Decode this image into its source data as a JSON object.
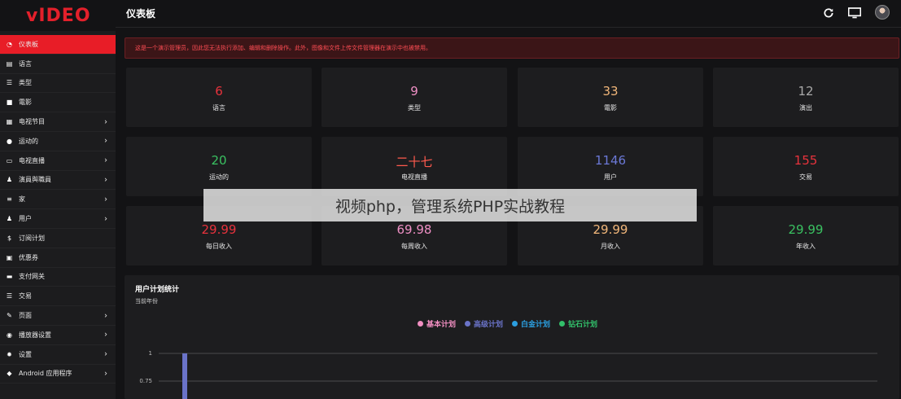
{
  "brand": {
    "logo_text": "vIDEO"
  },
  "header": {
    "title": "仪表板",
    "icons": [
      "refresh-icon",
      "monitor-icon",
      "avatar"
    ]
  },
  "alert": {
    "text": "这是一个演示管理员，因此您无法执行添加、编辑和删除操作。此外，图像和文件上传文件管理器在演示中也被禁用。"
  },
  "sidebar": {
    "items": [
      {
        "label": "仪表板",
        "icon": "dashboard-icon",
        "active": true,
        "chevron": false
      },
      {
        "label": "语言",
        "icon": "language-icon",
        "chevron": false
      },
      {
        "label": "类型",
        "icon": "list-icon",
        "chevron": false
      },
      {
        "label": "電影",
        "icon": "video-camera-icon",
        "chevron": false
      },
      {
        "label": "电视节目",
        "icon": "film-icon",
        "chevron": true
      },
      {
        "label": "运动的",
        "icon": "soccer-ball-icon",
        "chevron": true
      },
      {
        "label": "电视直播",
        "icon": "tv-icon",
        "chevron": true
      },
      {
        "label": "演員與職員",
        "icon": "users-icon",
        "chevron": true
      },
      {
        "label": "家",
        "icon": "sliders-icon",
        "chevron": true
      },
      {
        "label": "用户",
        "icon": "user-group-icon",
        "chevron": true
      },
      {
        "label": "订阅计划",
        "icon": "dollar-icon",
        "chevron": false
      },
      {
        "label": "优惠券",
        "icon": "gift-icon",
        "chevron": false
      },
      {
        "label": "支付网关",
        "icon": "credit-card-icon",
        "chevron": false
      },
      {
        "label": "交易",
        "icon": "list-icon",
        "chevron": false
      },
      {
        "label": "页面",
        "icon": "edit-icon",
        "chevron": true
      },
      {
        "label": "播放器设置",
        "icon": "play-circle-icon",
        "chevron": true
      },
      {
        "label": "设置",
        "icon": "gear-icon",
        "chevron": true
      },
      {
        "label": "Android 应用程序",
        "icon": "android-icon",
        "chevron": true
      }
    ]
  },
  "stats": [
    {
      "value": "6",
      "label": "语言",
      "color": "#e8323c"
    },
    {
      "value": "9",
      "label": "类型",
      "color": "#ee8fc4"
    },
    {
      "value": "33",
      "label": "電影",
      "color": "#f2b77a"
    },
    {
      "value": "12",
      "label": "演出",
      "color": "#a9a9a9"
    },
    {
      "value": "20",
      "label": "运动的",
      "color": "#3ac161"
    },
    {
      "value": "二十七",
      "label": "电视直播",
      "color": "#ff5a4e"
    },
    {
      "value": "1146",
      "label": "用户",
      "color": "#6b78d6"
    },
    {
      "value": "155",
      "label": "交易",
      "color": "#e8323c"
    },
    {
      "value": "29.99",
      "label": "每日收入",
      "color": "#e8323c"
    },
    {
      "value": "69.98",
      "label": "每周收入",
      "color": "#ee8fc4"
    },
    {
      "value": "29.99",
      "label": "月收入",
      "color": "#f2b77a"
    },
    {
      "value": "29.99",
      "label": "年收入",
      "color": "#3ac161"
    }
  ],
  "chart_section": {
    "title": "用户计划统计",
    "subtitle": "当前年份"
  },
  "chart_data": {
    "type": "bar",
    "title": "用户计划统计",
    "subtitle": "当前年份",
    "series": [
      {
        "name": "基本计划",
        "color": "#f28fc2"
      },
      {
        "name": "高级计划",
        "color": "#6a73c8"
      },
      {
        "name": "白金计划",
        "color": "#2b9fe0"
      },
      {
        "name": "钻石计划",
        "color": "#32c06a"
      }
    ],
    "y_ticks": [
      "1",
      "0.75"
    ],
    "first_bar": {
      "series": "高级计划",
      "value": 1
    },
    "grid": true,
    "legend": "top-center"
  },
  "watermark": {
    "text": "视频php，管理系统PHP实战教程"
  }
}
